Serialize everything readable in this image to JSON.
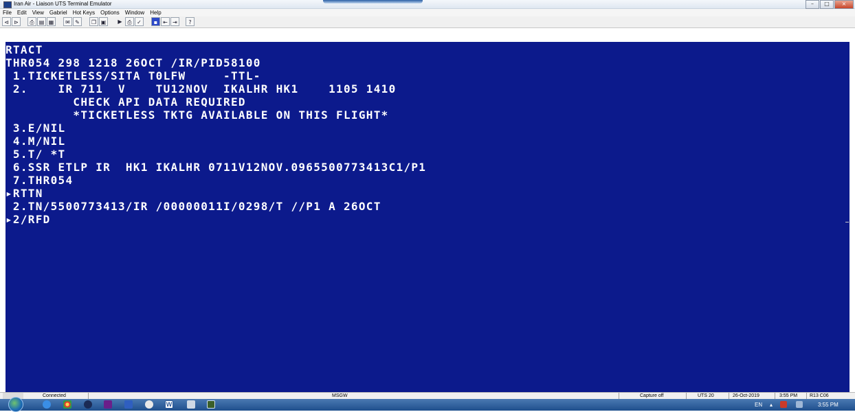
{
  "window": {
    "title": "Iran Air - Liaison UTS Terminal Emulator",
    "controls": {
      "minimize": "–",
      "maximize": "□",
      "close": "×"
    }
  },
  "menu": [
    "File",
    "Edit",
    "View",
    "Gabriel",
    "Hot Keys",
    "Options",
    "Window",
    "Help"
  ],
  "toolbar": {
    "icons": [
      "connect-icon",
      "disconnect-icon",
      "print-icon",
      "print-screen-icon",
      "print-setup-icon",
      "capture-icon",
      "capture-file-icon",
      "copy-icon",
      "paste-icon",
      "play-icon",
      "printer-icon",
      "check-icon",
      "window-icon",
      "split-left-icon",
      "split-right-icon",
      "help-icon"
    ]
  },
  "terminal": {
    "lines": [
      "RTACT",
      "THR054 298 1218 26OCT /IR/PID58100",
      " 1.TICKETLESS/SITA T0LFW     -TTL-",
      " 2.    IR 711  V    TU12NOV  IKALHR HK1    1105 1410",
      "         CHECK API DATA REQUIRED",
      "         *TICKETLESS TKTG AVAILABLE ON THIS FLIGHT*",
      " 3.E/NIL",
      " 4.M/NIL",
      " 5.T/ *T",
      " 6.SSR ETLP IR  HK1 IKALHR 0711V12NOV.0965500773413C1/P1",
      " 7.THR054",
      "▸RTTN",
      " 2.TN/5500773413/IR /00000011I/0298/T //P1 A 26OCT",
      "▸2/RFD"
    ]
  },
  "status": {
    "connection": "Connected",
    "host": "MSGW",
    "capture": "Capture off",
    "session": "UTS 20",
    "date": "26-Oct-2019",
    "time": "3:55 PM",
    "position": "R13 C06"
  },
  "taskbar": {
    "language": "EN",
    "clock": "3:55 PM",
    "word_label": "W"
  }
}
